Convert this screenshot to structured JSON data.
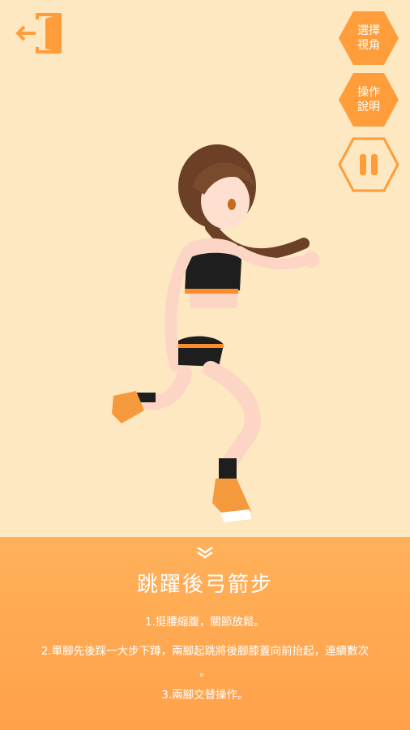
{
  "buttons": {
    "exit_icon": "exit-door-icon",
    "view_angle_label": "選擇\n視角",
    "instructions_label": "操作\n說明",
    "pause_icon": "pause-icon"
  },
  "colors": {
    "background": "#fde8c2",
    "accent": "#ff9d3a",
    "panel": "#ffa54f"
  },
  "exercise": {
    "title": "跳躍後弓箭步",
    "steps": [
      "1.挺腰縮腹，關節放鬆。",
      "2.單腳先後踩一大步下蹲，兩腳起跳將後腳膝蓋向前抬起，連續數次\n。",
      "3.兩腳交替操作。"
    ]
  }
}
